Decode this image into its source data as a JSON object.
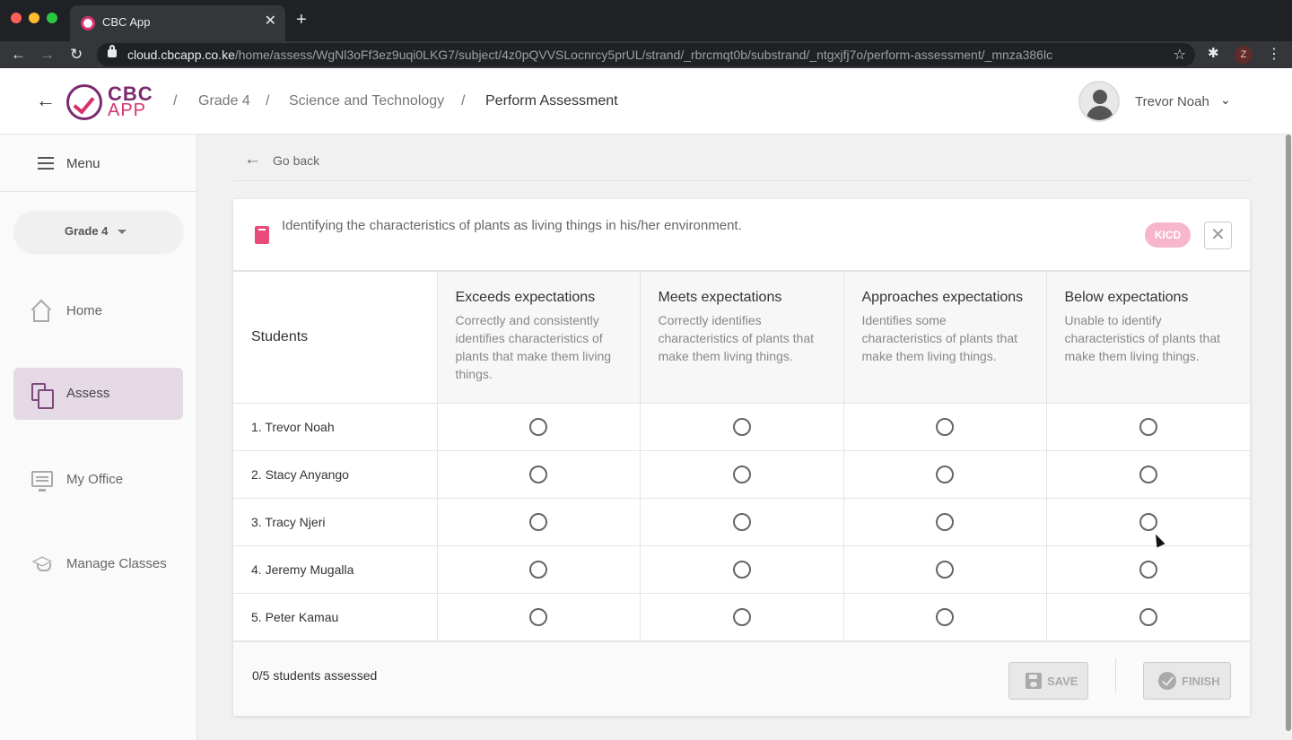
{
  "browser": {
    "tab_title": "CBC App",
    "url_domain": "cloud.cbcapp.co.ke",
    "url_path": "/home/assess/WgNl3oFf3ez9uqi0LKG7/subject/4z0pQVVSLocnrcy5prUL/strand/_rbrcmqt0b/substrand/_ntgxjfj7o/perform-assessment/_mnza386lc",
    "profile_initial": "Z"
  },
  "header": {
    "logo_top": "CBC",
    "logo_bottom": "APP",
    "breadcrumb": [
      "Grade 4",
      "Science and Technology",
      "Perform Assessment"
    ],
    "user_name": "Trevor Noah"
  },
  "sidebar": {
    "menu_label": "Menu",
    "grade": "Grade 4",
    "items": [
      {
        "label": "Home",
        "icon": "home-icon"
      },
      {
        "label": "Assess",
        "icon": "documents-icon",
        "active": true
      },
      {
        "label": "My Office",
        "icon": "office-icon"
      },
      {
        "label": "Manage Classes",
        "icon": "graduation-cap-icon"
      }
    ]
  },
  "main": {
    "go_back": "Go back",
    "card": {
      "title": "Identifying the characteristics of plants as living things in his/her environment.",
      "badge": "KICD",
      "students_header": "Students",
      "levels": [
        {
          "title": "Exceeds expectations",
          "desc": "Correctly and consistently identifies characteristics of plants that make them living things."
        },
        {
          "title": "Meets expectations",
          "desc": "Correctly identifies characteristics of plants that make them living things."
        },
        {
          "title": "Approaches expectations",
          "desc": "Identifies some characteristics of plants that make them living things."
        },
        {
          "title": "Below expectations",
          "desc": "Unable to identify characteristics of plants that make them living things."
        }
      ],
      "students": [
        "1. Trevor Noah",
        "2. Stacy Anyango",
        "3. Tracy Njeri",
        "4. Jeremy Mugalla",
        "5. Peter Kamau"
      ],
      "assessed_count": "0/5 students assessed",
      "save_label": "SAVE",
      "finish_label": "FINISH"
    }
  },
  "colors": {
    "brand_purple": "#7b2a6e",
    "brand_pink": "#d6336c",
    "active_nav_bg": "#e6d9e6",
    "badge_bg": "#f7b6cc"
  }
}
